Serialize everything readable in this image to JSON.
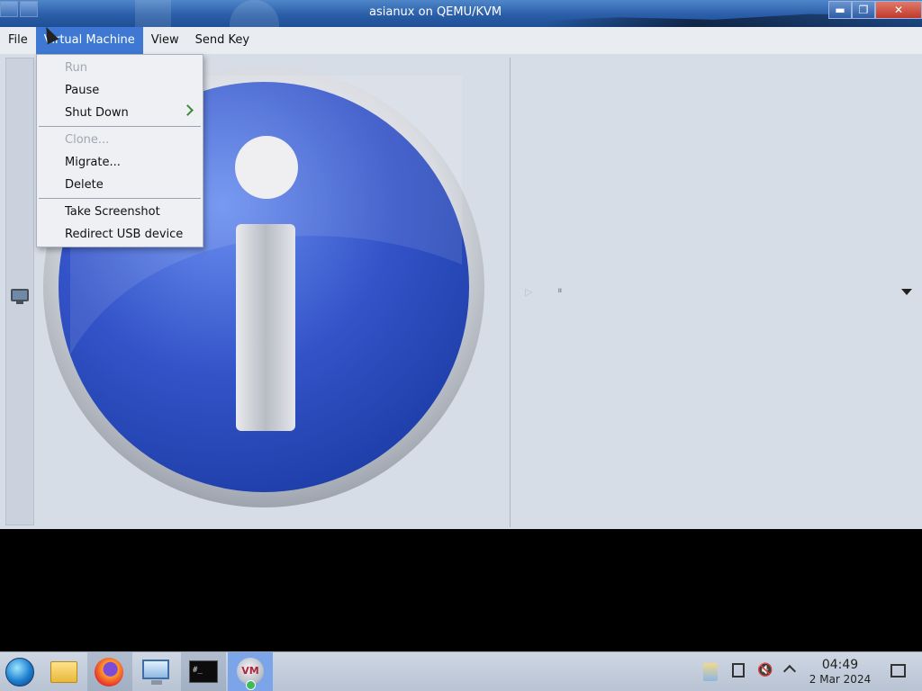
{
  "window": {
    "title": "asianux on QEMU/KVM",
    "controls": {
      "minimize": "▬",
      "maximize": "❐",
      "close": "✕"
    }
  },
  "menubar": {
    "items": [
      "File",
      "Virtual Machine",
      "View",
      "Send Key"
    ],
    "active_item": "Virtual Machine"
  },
  "vm_menu": {
    "items": [
      {
        "label": "Run",
        "enabled": false
      },
      {
        "label": "Pause",
        "enabled": true
      },
      {
        "label": "Shut Down",
        "enabled": true,
        "submenu": true
      },
      {
        "label": "Clone...",
        "enabled": false
      },
      {
        "label": "Migrate...",
        "enabled": true
      },
      {
        "label": "Delete",
        "enabled": true
      },
      {
        "label": "Take Screenshot",
        "enabled": true
      },
      {
        "label": "Redirect USB device",
        "enabled": true
      }
    ]
  },
  "toolbar": {
    "play_glyph": "▷",
    "pause_glyph": "⏸"
  },
  "taskbar": {
    "apps": [
      "start-menu",
      "file-manager",
      "firefox",
      "remote-desktop",
      "terminal",
      "virt-manager"
    ],
    "terminal_glyph": "#_",
    "vm_glyph": "VM",
    "volume_glyph": "🔇",
    "clock": {
      "time": "04:49",
      "date": "2 Mar 2024"
    }
  },
  "colors": {
    "accent": "#3e78d2",
    "info_blue": "#2f52c4",
    "menu_bg": "#eef0f4"
  }
}
